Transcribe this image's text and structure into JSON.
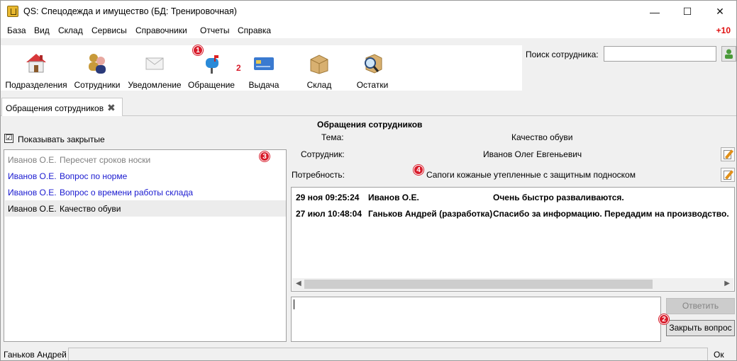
{
  "window": {
    "title": "QS: Спецодежда и имущество (БД: Тренировочная)",
    "minimize": "—",
    "maximize": "☐",
    "close": "✕"
  },
  "menu": {
    "items": [
      "База",
      "Вид",
      "Склад",
      "Сервисы",
      "Справочники",
      "Отчеты",
      "Справка"
    ],
    "notifications": "+10"
  },
  "toolbar": {
    "items": [
      {
        "label": "Подразделения",
        "icon": "home-icon"
      },
      {
        "label": "Сотрудники",
        "icon": "users-icon"
      },
      {
        "label": "Уведомление",
        "icon": "envelope-icon"
      },
      {
        "label": "Обращение",
        "icon": "mailbox-icon",
        "badge": "2"
      },
      {
        "label": "Выдача",
        "icon": "card-icon"
      },
      {
        "label": "Склад",
        "icon": "box-icon"
      },
      {
        "label": "Остатки",
        "icon": "search-box-icon"
      }
    ]
  },
  "search": {
    "label": "Поиск сотрудника:",
    "value": ""
  },
  "tab": {
    "label": "Обращения сотрудников",
    "close": "✖"
  },
  "left_panel": {
    "show_closed_label": "Показывать закрытые",
    "show_closed_checked": "☑",
    "items": [
      {
        "author": "Иванов О.Е.",
        "subject": "Пересчет сроков носки",
        "state": "closed"
      },
      {
        "author": "Иванов О.Е.",
        "subject": "Вопрос по норме",
        "state": "open"
      },
      {
        "author": "Иванов О.Е.",
        "subject": "Вопрос о времени работы склада",
        "state": "open"
      },
      {
        "author": "Иванов О.Е.",
        "subject": "Качество обуви",
        "state": "selected"
      }
    ]
  },
  "detail": {
    "heading": "Обращения сотрудников",
    "topic_label": "Тема:",
    "topic_value": "Качество обуви",
    "employee_label": "Сотрудник:",
    "employee_value": "Иванов Олег Евгеньевич",
    "need_label": "Потребность:",
    "need_value": "Сапоги кожаные утепленные с защитным подноском",
    "messages": [
      {
        "time": "29 ноя 09:25:24",
        "author": "Иванов О.Е.",
        "text": "Очень быстро разваливаются."
      },
      {
        "time": "27 июл 10:48:04",
        "author": "Ганьков Андрей (разработка)",
        "text": "Спасибо за информацию. Передадим на производство."
      }
    ],
    "reply_value": "",
    "reply_button": "Ответить",
    "close_question_button": "Закрыть вопрос"
  },
  "status": {
    "user": "Ганьков Андрей",
    "state": "Ок"
  },
  "markers": [
    "1",
    "2",
    "3",
    "4"
  ],
  "colors": {
    "link_blue": "#1a1ad0",
    "closed_gray": "#808080",
    "selected_row": "#ececec",
    "marker_red": "#d81b2a",
    "notif_red": "#e01010"
  }
}
